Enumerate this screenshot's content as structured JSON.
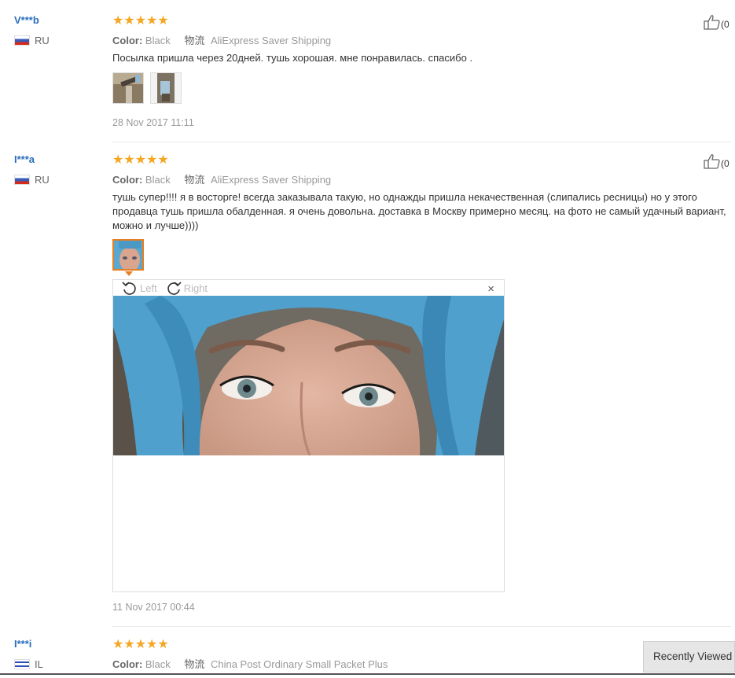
{
  "reviews": [
    {
      "user": "V***b",
      "country": "RU",
      "color_label": "Color:",
      "color_value": "Black",
      "logistics_label": "物流",
      "shipping": "AliExpress Saver Shipping",
      "text": "Посылка пришла через 20дней. тушь хорошая. мне понравилась. спасибо .",
      "date": "28 Nov 2017 11:11",
      "likes": "(0"
    },
    {
      "user": "I***a",
      "country": "RU",
      "color_label": "Color:",
      "color_value": "Black",
      "logistics_label": "物流",
      "shipping": "AliExpress Saver Shipping",
      "text": "тушь супер!!!! я в восторге! всегда заказывала такую, но однажды пришла некачественная (слипались ресницы) но у этого продавца тушь пришла обалденная. я очень довольна. доставка в Москву примерно месяц. на фото не самый удачный вариант, можно и лучше))))",
      "date": "11 Nov 2017 00:44",
      "likes": "(0"
    },
    {
      "user": "I***i",
      "country": "IL",
      "color_label": "Color:",
      "color_value": "Black",
      "logistics_label": "物流",
      "shipping": "China Post Ordinary Small Packet Plus"
    }
  ],
  "stars": "★★★★★",
  "viewer": {
    "rotate_left": "Left",
    "rotate_right": "Right",
    "close": "×"
  },
  "recently_viewed": "Recently Viewed",
  "colors": {
    "link": "#2a6ebb",
    "star": "#f5a623",
    "accent": "#e67e22"
  }
}
